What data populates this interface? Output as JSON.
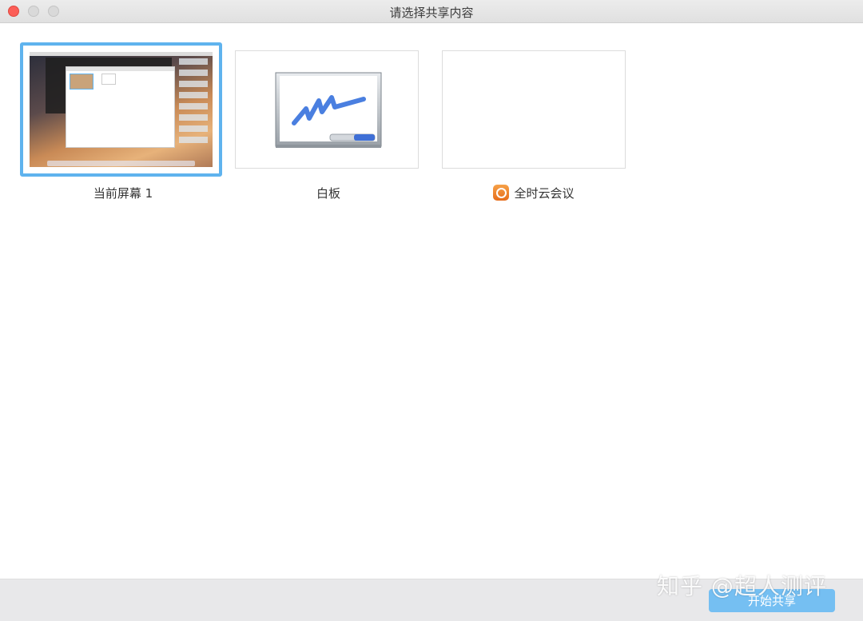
{
  "window": {
    "title": "请选择共享内容"
  },
  "share_options": [
    {
      "label": "当前屏幕 1",
      "selected": true
    },
    {
      "label": "白板",
      "selected": false
    },
    {
      "label": "全时云会议",
      "selected": false,
      "icon": "app-clock-icon"
    }
  ],
  "footer": {
    "start_button": "开始共享"
  },
  "watermark": "知乎 @超人测评",
  "colors": {
    "selection": "#5fb3ee",
    "primary_button": "#75bff2",
    "close_button": "#fc5e57"
  }
}
